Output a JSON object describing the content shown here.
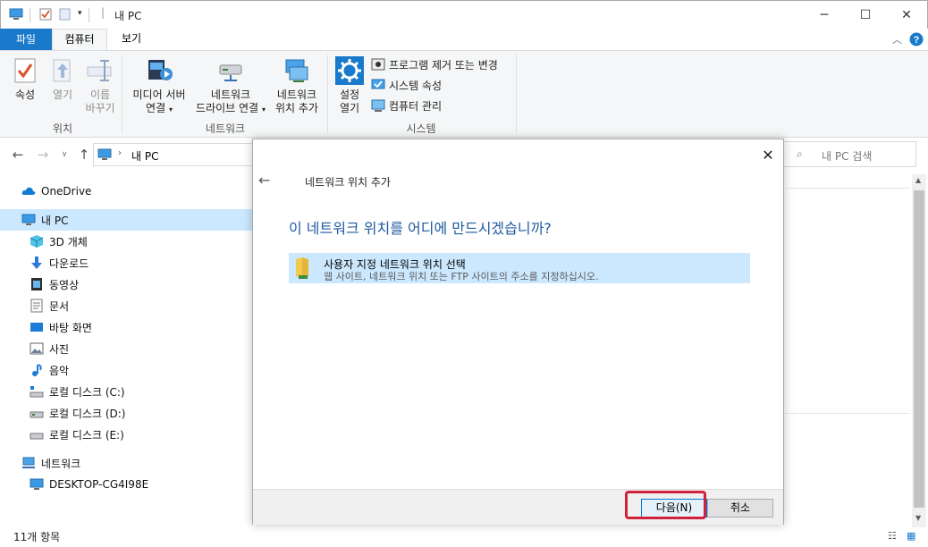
{
  "window": {
    "title": "내 PC",
    "controls": {
      "minimize": "─",
      "maximize": "☐",
      "close": "✕"
    }
  },
  "ribbon": {
    "tabs": {
      "file": "파일",
      "computer": "컴퓨터",
      "view": "보기"
    },
    "groups": {
      "location": {
        "label": "위치",
        "properties": "속성",
        "open": "열기",
        "rename_line1": "이름",
        "rename_line2": "바꾸기"
      },
      "network": {
        "label": "네트워크",
        "media_line1": "미디어 서버",
        "media_line2": "연결",
        "drive_line1": "네트워크",
        "drive_line2": "드라이브 연결",
        "addloc_line1": "네트워크",
        "addloc_line2": "위치 추가"
      },
      "system": {
        "label": "시스템",
        "settings_line1": "설정",
        "settings_line2": "열기",
        "uninstall": "프로그램 제거 또는 변경",
        "system_props": "시스템 속성",
        "manage": "컴퓨터 관리"
      }
    },
    "collapse_icon": "chevron-up-icon",
    "help_icon": "help-icon"
  },
  "address": {
    "path": "내 PC",
    "search_placeholder": "내 PC 검색"
  },
  "sidebar": {
    "items": [
      {
        "label": "OneDrive",
        "icon": "cloud-icon"
      },
      {
        "label": "내 PC",
        "icon": "computer-icon"
      },
      {
        "label": "3D 개체",
        "icon": "cube-icon"
      },
      {
        "label": "다운로드",
        "icon": "download-icon"
      },
      {
        "label": "동영상",
        "icon": "video-icon"
      },
      {
        "label": "문서",
        "icon": "document-icon"
      },
      {
        "label": "바탕 화면",
        "icon": "desktop-icon"
      },
      {
        "label": "사진",
        "icon": "picture-icon"
      },
      {
        "label": "음악",
        "icon": "music-icon"
      },
      {
        "label": "로컬 디스크 (C:)",
        "icon": "drive-icon"
      },
      {
        "label": "로컬 디스크 (D:)",
        "icon": "drive-icon"
      },
      {
        "label": "로컬 디스크 (E:)",
        "icon": "drive-icon"
      },
      {
        "label": "네트워크",
        "icon": "network-icon"
      },
      {
        "label": "DESKTOP-CG4I98E",
        "icon": "computer-icon"
      }
    ]
  },
  "status": {
    "item_count": "11개 항목"
  },
  "dialog": {
    "title": "네트워크 위치 추가",
    "heading": "이 네트워크 위치를 어디에 만드시겠습니까?",
    "option": {
      "title": "사용자 지정 네트워크 위치 선택",
      "description": "웹 사이트, 네트워크 위치 또는 FTP 사이트의 주소를 지정하십시오."
    },
    "buttons": {
      "next": "다음(N)",
      "cancel": "취소"
    },
    "highlight_color": "#d0213d"
  },
  "colors": {
    "accent": "#1979ca",
    "selection": "#cce8ff",
    "heading_blue": "#1e5aa0"
  }
}
